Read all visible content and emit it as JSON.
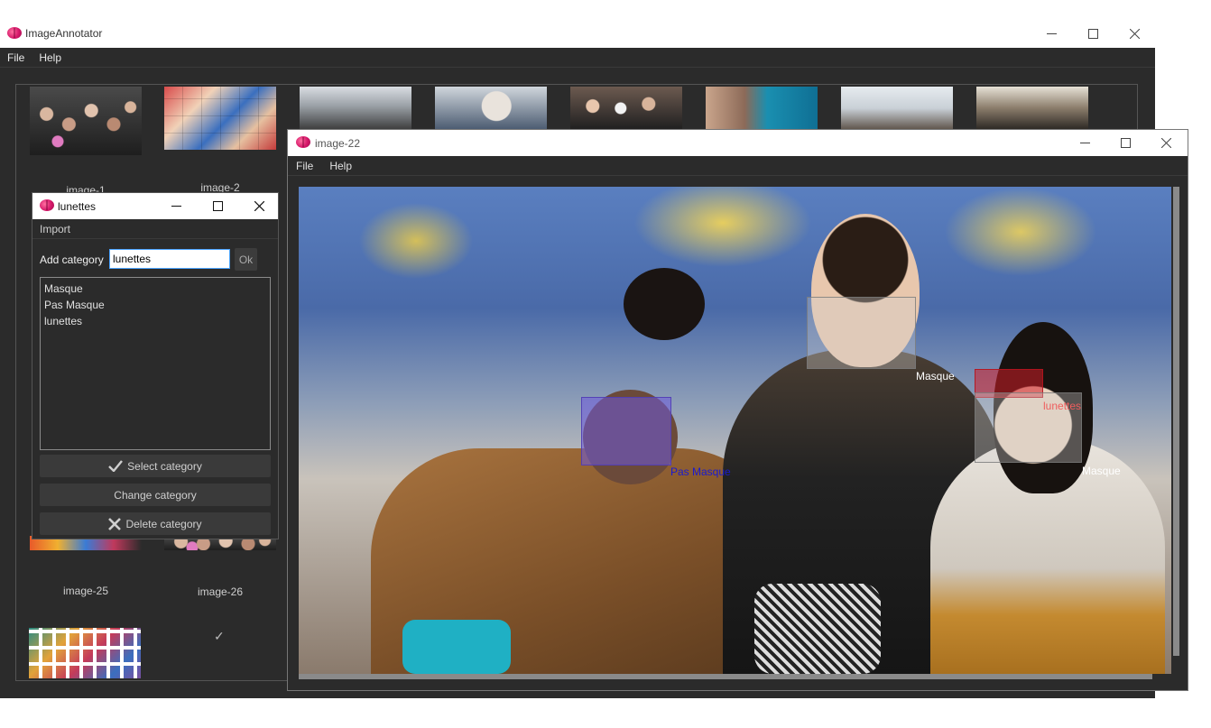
{
  "main_window": {
    "title": "ImageAnnotator",
    "menu": [
      "File",
      "Help"
    ]
  },
  "gallery": {
    "thumbnails": [
      {
        "caption": "image-1",
        "style": "crowd"
      },
      {
        "caption": "image-2",
        "style": "grid-faces"
      },
      {
        "caption": "",
        "style": "street"
      },
      {
        "caption": "",
        "style": "elder"
      },
      {
        "caption": "",
        "style": "subway"
      },
      {
        "caption": "",
        "style": "blue77"
      },
      {
        "caption": "",
        "style": "tower"
      },
      {
        "caption": "",
        "style": "train"
      },
      {
        "caption": "image-25",
        "style": "colorful"
      },
      {
        "caption": "image-26",
        "style": "crowd"
      },
      {
        "caption": "",
        "style": "icons-grid"
      }
    ],
    "checkmark": "✓"
  },
  "category_dialog": {
    "title": "lunettes",
    "menu": [
      "Import"
    ],
    "add_label": "Add category",
    "input_value": "lunettes",
    "ok_label": "Ok",
    "categories": [
      "Masque",
      "Pas Masque",
      "lunettes"
    ],
    "select_label": "Select category",
    "change_label": "Change category",
    "delete_label": "Delete category"
  },
  "image_window": {
    "title": "image-22",
    "menu": [
      "File",
      "Help"
    ],
    "annotations": [
      {
        "label": "Masque",
        "color": "#ffffff",
        "fill": "rgba(210,210,210,0.35)"
      },
      {
        "label": "Pas Masque",
        "color": "#1a1ad0",
        "fill": "rgba(110,90,220,0.55)"
      },
      {
        "label": "lunettes",
        "color": "#ff2020",
        "fill": "rgba(210,30,40,0.55)"
      },
      {
        "label": "Masque",
        "color": "#ffffff",
        "fill": "rgba(210,210,210,0.35)"
      }
    ]
  }
}
